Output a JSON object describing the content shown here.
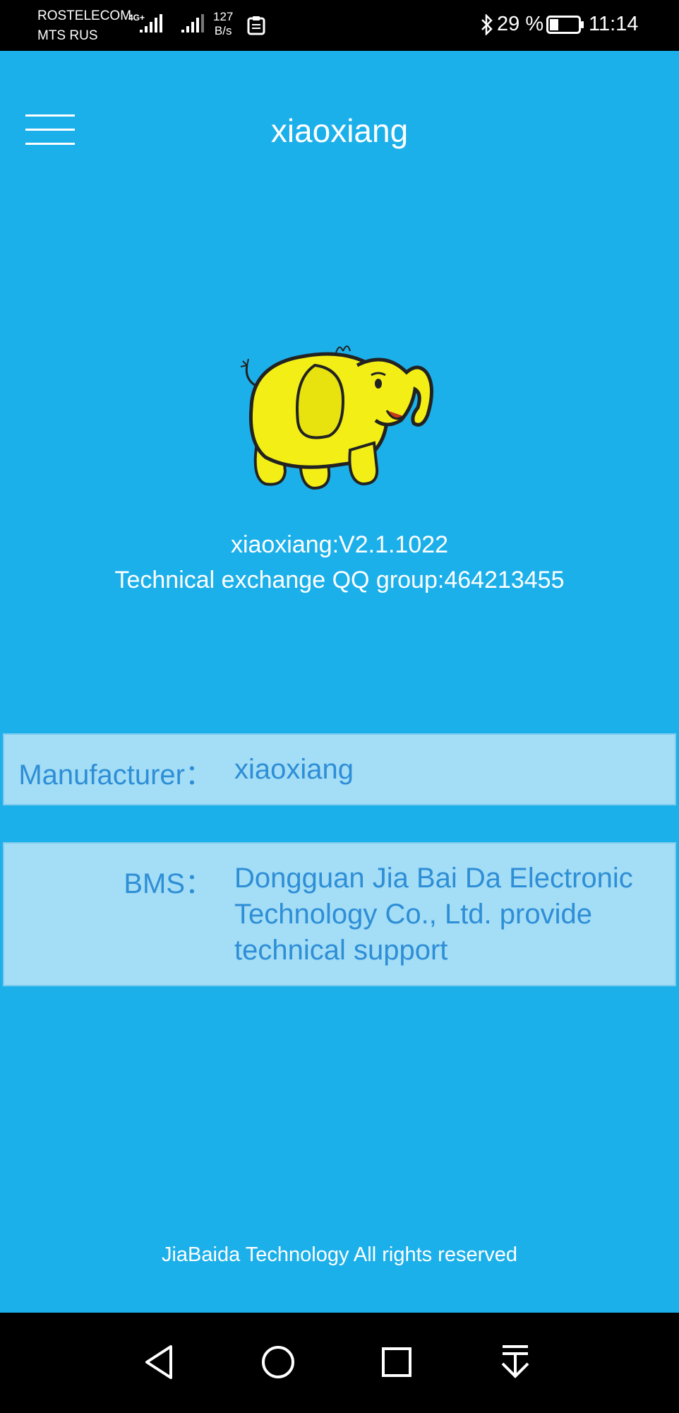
{
  "status_bar": {
    "carrier_1": "ROSTELECOM",
    "carrier_2": "MTS RUS",
    "network_type": "4G+",
    "speed_value": "127",
    "speed_unit": "B/s",
    "battery_percent": "29 %",
    "time": "11:14",
    "icons": [
      "signal-icon",
      "signal-icon",
      "clipboard-icon",
      "bluetooth-icon",
      "battery-icon"
    ]
  },
  "header": {
    "title": "xiaoxiang",
    "menu_icon": "hamburger-menu-icon"
  },
  "about": {
    "logo_icon": "yellow-elephant-logo",
    "version": "xiaoxiang:V2.1.1022",
    "qq_group": "Technical exchange QQ group:464213455"
  },
  "info": {
    "manufacturer_label": "Manufacturer：",
    "manufacturer_value": "xiaoxiang",
    "bms_label": "BMS：",
    "bms_value": "Dongguan Jia Bai Da Electronic Technology Co., Ltd. provide technical support"
  },
  "footer": {
    "copyright": "JiaBaida Technology All rights reserved"
  },
  "nav_bar": {
    "icons": [
      "back-icon",
      "home-icon",
      "recent-apps-icon",
      "notification-pull-down-icon"
    ]
  },
  "colors": {
    "background": "#1cb0ea",
    "card_background": "#a3ddf6",
    "card_text": "#2e8ed6",
    "text": "#ffffff"
  }
}
